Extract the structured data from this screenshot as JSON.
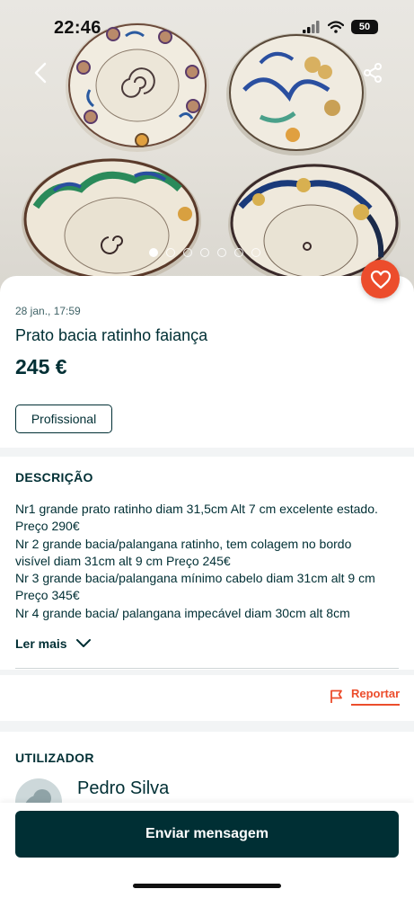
{
  "status_bar": {
    "time": "22:46",
    "battery": "50"
  },
  "gallery": {
    "image_count": 7,
    "active_index": 0
  },
  "listing": {
    "date": "28 jan., 17:59",
    "title": "Prato bacia ratinho faiança",
    "price": "245 €",
    "seller_type": "Profissional"
  },
  "description": {
    "heading": "DESCRIÇÃO",
    "lines": [
      "Nr1 grande prato ratinho diam 31,5cm Alt 7 cm  excelente estado.",
      "Preço 290€",
      "Nr 2 grande bacia/palangana ratinho, tem colagem no bordo",
      "visível diam 31cm alt 9 cm  Preço 245€",
      "Nr 3 grande bacia/palangana mínimo cabelo diam 31cm alt 9 cm",
      "Preço 345€",
      "Nr 4 grande bacia/ palangana impecável diam 30cm alt 8cm"
    ],
    "read_more": "Ler mais"
  },
  "report": {
    "label": "Reportar"
  },
  "user": {
    "heading": "UTILIZADOR",
    "name": "Pedro Silva"
  },
  "actions": {
    "send_message": "Enviar mensagem"
  },
  "colors": {
    "brand_dark": "#002f34",
    "accent": "#ec4d2c",
    "separator": "#f2f4f5"
  },
  "icons": {
    "back": "chevron-left-icon",
    "share": "share-icon",
    "favorite": "heart-icon",
    "report": "flag-icon",
    "read_more": "chevron-down-icon"
  }
}
